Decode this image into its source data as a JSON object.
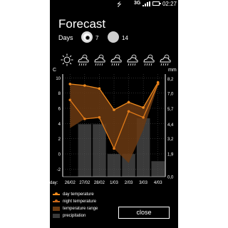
{
  "status": {
    "network": "3G",
    "time": "02:27",
    "usb_icon": "usb-icon",
    "battery_icon": "battery-icon"
  },
  "title": "Forecast",
  "days": {
    "label": "Days",
    "options": [
      "7",
      "14"
    ],
    "selected": "7"
  },
  "weather_icons": [
    "sun-icon",
    "cloud-rain-icon",
    "cloud-rain-icon",
    "cloud-rain-icon",
    "cloud-rain-icon",
    "cloud-rain-icon",
    "cloud-rain-icon"
  ],
  "chart_data": {
    "type": "line",
    "title": "",
    "y_left_label": "C",
    "y_right_label": "mm",
    "y_left_ticks": [
      "10",
      "8",
      "6",
      "4",
      "2",
      "0",
      "-2"
    ],
    "y_right_ticks": [
      "8,2",
      "7,0",
      "5,7",
      "4,4",
      "3,2",
      "1,9",
      "0,0"
    ],
    "x_label": "day:",
    "categories": [
      "26/02",
      "27/02",
      "28/02",
      "1/03",
      "2/03",
      "3/03",
      "4/03"
    ],
    "ylim": [
      -3,
      10.5
    ],
    "series": [
      {
        "name": "day temperature",
        "values": [
          9.2,
          9.0,
          8.6,
          5.8,
          6.8,
          6.1,
          9.4
        ]
      },
      {
        "name": "night temperature",
        "values": [
          7.1,
          4.6,
          4.8,
          0.7,
          5.6,
          4.8,
          9.2
        ]
      }
    ],
    "temperature_range": {
      "name": "temperature range",
      "low": [
        3.4,
        4.6,
        4.8,
        0.7,
        -1.2,
        3.2,
        9.0
      ],
      "high": [
        9.2,
        9.0,
        8.6,
        5.8,
        6.8,
        6.1,
        9.4
      ]
    },
    "precipitation": {
      "name": "precipitation",
      "values": [
        0.0,
        4.4,
        4.4,
        1.9,
        1.9,
        4.9,
        1.3
      ]
    },
    "colors": {
      "line": "#f08a1c",
      "band": "#6b3a12",
      "bar": "#3a3a3a",
      "grid": "#555555"
    }
  },
  "legend": [
    "day temperature",
    "night temperature",
    "temperature range",
    "precipitation"
  ],
  "close_label": "close"
}
